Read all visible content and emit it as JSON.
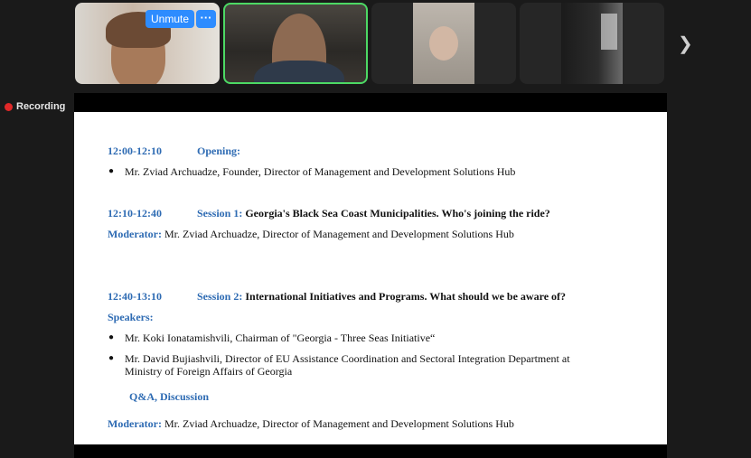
{
  "participants": {
    "tile1": {
      "unmute_label": "Unmute",
      "more_label": "···"
    }
  },
  "sidebar": {
    "recording_label": "Recording"
  },
  "doc": {
    "opening": {
      "time": "12:00-12:10",
      "label": "Opening:"
    },
    "opening_items": [
      "Mr. Zviad Archuadze, Founder, Director of Management and Development Solutions Hub"
    ],
    "session1": {
      "time": "12:10-12:40",
      "prefix": "Session 1:",
      "title": "Georgia's Black Sea Coast Municipalities. Who's joining the ride?"
    },
    "moderator1": {
      "label": "Moderator:",
      "text": "Mr. Zviad Archuadze, Director of Management and Development Solutions Hub"
    },
    "session2": {
      "time": "12:40-13:10",
      "prefix": "Session 2:",
      "title": "International Initiatives and Programs. What should we be aware of?"
    },
    "speakers_label": "Speakers:",
    "speakers": [
      "Mr. Koki Ionatamishvili, Chairman of \"Georgia - Three Seas Initiative“",
      "Mr. David Bujiashvili, Director of EU Assistance Coordination and Sectoral Integration Department at",
      "Ministry of Foreign Affairs of Georgia"
    ],
    "qa_label": "Q&A, Discussion",
    "moderator2": {
      "label": "Moderator:",
      "text": "Mr. Zviad Archuadze, Director of Management and Development Solutions Hub"
    }
  },
  "colors": {
    "accent": "#2d8cff",
    "doc_heading": "#2e6bb3",
    "active_border": "#4cd964",
    "recording": "#e02828"
  }
}
